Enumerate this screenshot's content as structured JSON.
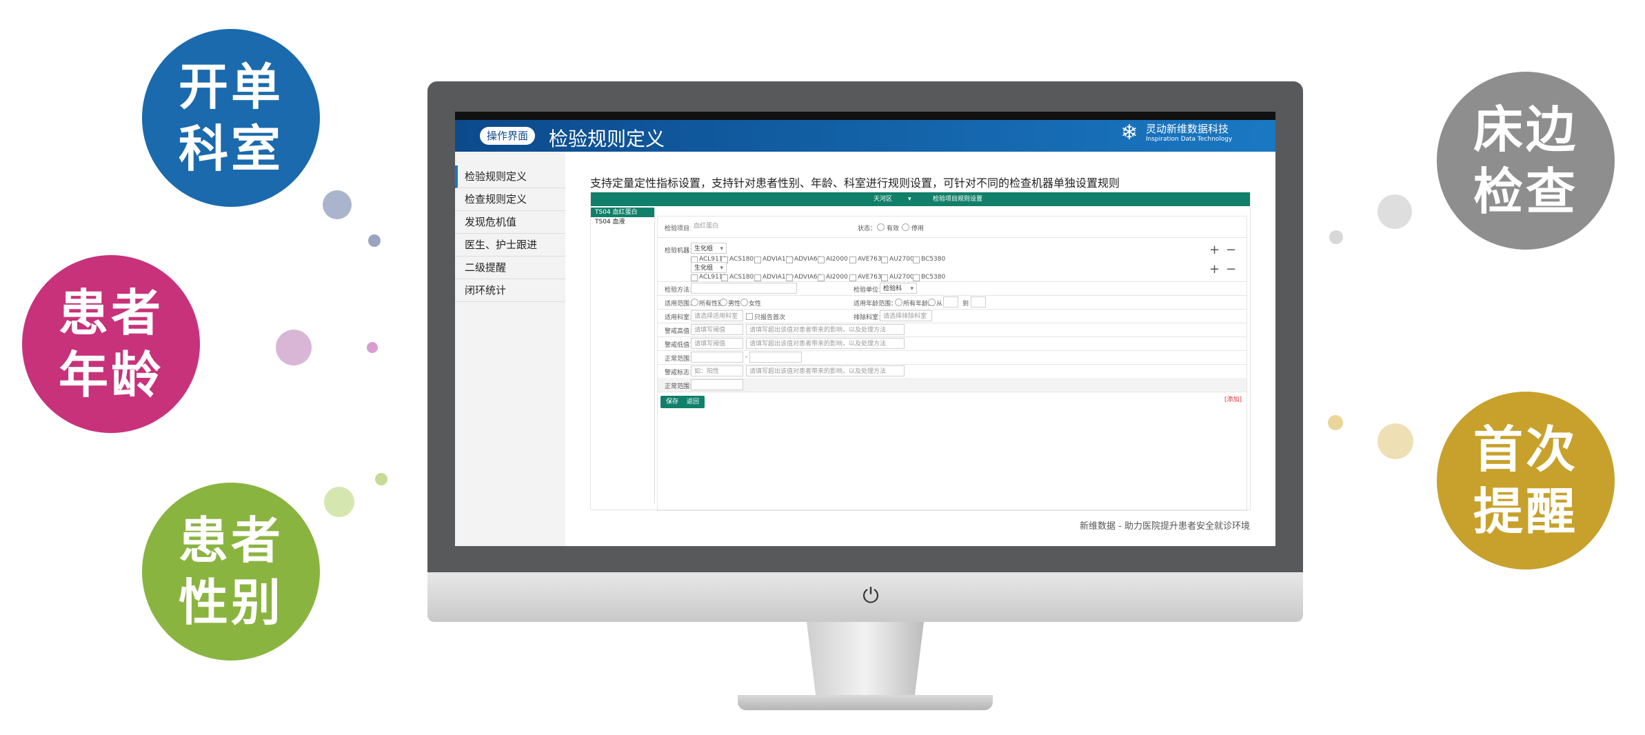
{
  "colors": {
    "blue_bubble": "#1a6aad",
    "magenta_bubble": "#c8327a",
    "green_bubble": "#8ab440",
    "gray_bubble": "#8e8e8e",
    "gold_bubble": "#c7a12b",
    "header_accent": "#11806a",
    "header_bar": "#0c4a8c"
  },
  "bubbles": {
    "kaidan": {
      "line1": "开单",
      "line2": "科室"
    },
    "nianling": {
      "line1": "患者",
      "line2": "年龄"
    },
    "xingbie": {
      "line1": "患者",
      "line2": "性别"
    },
    "chuangbian": {
      "line1": "床边",
      "line2": "检查"
    },
    "shouci": {
      "line1": "首次",
      "line2": "提醒"
    }
  },
  "header": {
    "op_label": "操作界面",
    "title": "检验规则定义",
    "logo_cn": "灵动新维数据科技",
    "logo_en": "Inspiration Data Technology",
    "logo_icon": "snowflake-logo-icon"
  },
  "sidebar": {
    "items": [
      {
        "label": "检验规则定义"
      },
      {
        "label": "检查规则定义"
      },
      {
        "label": "发现危机值"
      },
      {
        "label": "医生、护士跟进"
      },
      {
        "label": "二级提醒"
      },
      {
        "label": "闭环统计"
      }
    ]
  },
  "main": {
    "description": "支持定量定性指标设置，支持针对患者性别、年龄、科室进行规则设置，可针对不同的检查机器单独设置规则",
    "inner_header_left": "天河区",
    "inner_header_right": "检验项目规则设置",
    "list": [
      {
        "label": "TS04 血红蛋白"
      },
      {
        "label": "TS04 血液"
      }
    ],
    "form": {
      "item_label": "检验项目：",
      "item_value": "血红蛋白",
      "status_label": "状态：",
      "status_options": [
        "有效",
        "停用"
      ],
      "machine_label": "检验机器：",
      "machine_select": "生化组",
      "machines": [
        "ACL9111",
        "ACS180",
        "ADVIA120",
        "ADVIA60",
        "AI2000",
        "AVE763",
        "AU2700",
        "BC5380"
      ],
      "method_label": "检验方法：",
      "unit_label": "检验单位：",
      "unit_value": "检验科",
      "scope_label": "适用范围：",
      "scope_options": [
        "所有性别",
        "男性",
        "女性"
      ],
      "age_label": "适用年龄范围：",
      "age_options": [
        "所有年龄段",
        "从"
      ],
      "age_to": "到",
      "dept_label": "适用科室：",
      "dept_placeholder": "请选择适用科室",
      "first_only": "只报告首次",
      "exclude_label": "排除科室：",
      "exclude_placeholder": "请选择排除科室",
      "warn_high_label": "警戒高值：",
      "warn_high_placeholder": "请填写阈值",
      "warn_high_note": "请填写超出该值对患者带来的影响，以及处理方法",
      "warn_low_label": "警戒低值：",
      "warn_low_placeholder": "请填写阈值",
      "warn_low_note": "请填写超出该值对患者带来的影响，以及处理方法",
      "normal_label": "正常范围：",
      "normal_dash": "-",
      "warn_mark_label": "警戒标志：",
      "warn_mark_placeholder": "如：阳性",
      "warn_mark_note": "请填写超出该值对患者带来的影响，以及处理方法",
      "normal2_label": "正常范围：",
      "save": "保存",
      "back": "返回",
      "add": "[添加]"
    },
    "footer": "新维数据 - 助力医院提升患者安全就诊环境"
  }
}
